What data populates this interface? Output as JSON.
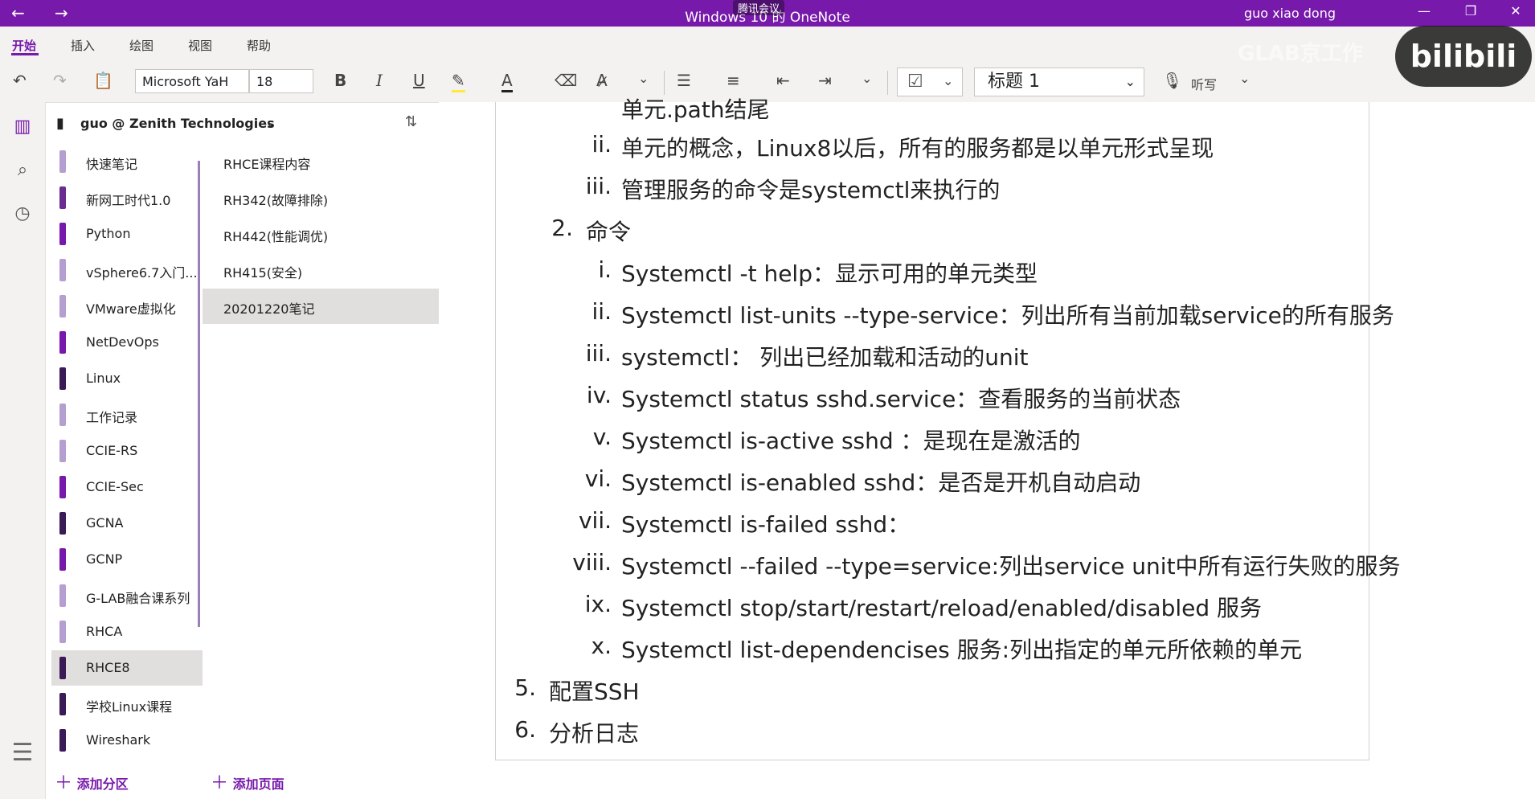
{
  "titlebar": {
    "back": "←",
    "forward": "→",
    "title": "Windows 10 的 OneNote",
    "meeting": "腾讯会议",
    "user": "guo xiao dong",
    "minimize": "—",
    "restore": "❐",
    "close": "✕"
  },
  "menu": [
    "开始",
    "插入",
    "绘图",
    "视图",
    "帮助"
  ],
  "toolbar": {
    "font_name": "Microsoft YaH",
    "font_size": "18",
    "bold": "B",
    "italic": "I",
    "underline": "U",
    "style": "标题 1",
    "dictate": "听写"
  },
  "overlay": {
    "logo": "bilibili",
    "watermark": "GLAB京工作"
  },
  "notebook": {
    "name": "guo @ Zenith Technologies"
  },
  "sections": [
    {
      "label": "快速笔记",
      "color": "#b49fd0"
    },
    {
      "label": "新网工时代1.0",
      "color": "#6a2c91"
    },
    {
      "label": "Python",
      "color": "#7719aa"
    },
    {
      "label": "vSphere6.7入门...",
      "color": "#b49fd0"
    },
    {
      "label": "VMware虚拟化",
      "color": "#b49fd0"
    },
    {
      "label": "NetDevOps",
      "color": "#7719aa"
    },
    {
      "label": "Linux",
      "color": "#3a1b55"
    },
    {
      "label": "工作记录",
      "color": "#b49fd0"
    },
    {
      "label": "CCIE-RS",
      "color": "#b49fd0"
    },
    {
      "label": "CCIE-Sec",
      "color": "#7719aa"
    },
    {
      "label": "GCNA",
      "color": "#3a1b55"
    },
    {
      "label": "GCNP",
      "color": "#7719aa"
    },
    {
      "label": "G-LAB融合课系列",
      "color": "#b49fd0"
    },
    {
      "label": "RHCA",
      "color": "#b49fd0"
    },
    {
      "label": "RHCE8",
      "color": "#3a1b55"
    },
    {
      "label": "学校Linux课程",
      "color": "#3a1b55"
    },
    {
      "label": "Wireshark",
      "color": "#3a1b55"
    }
  ],
  "pages": [
    {
      "label": "RHCE课程内容"
    },
    {
      "label": "RH342(故障排除)"
    },
    {
      "label": "RH442(性能调优)"
    },
    {
      "label": "RH415(安全)"
    },
    {
      "label": "20201220笔记"
    }
  ],
  "footer": {
    "add_section": "添加分区",
    "add_page": "添加页面"
  },
  "note_lines": [
    {
      "num": "",
      "text": "单元.path结尾"
    },
    {
      "num": "ii.",
      "text": "单元的概念，Linux8以后，所有的服务都是以单元形式呈现"
    },
    {
      "num": "iii.",
      "text": "管理服务的命令是systemctl来执行的"
    },
    {
      "num": "2.",
      "text": "命令"
    },
    {
      "num": "i.",
      "text": "Systemctl -t help：显示可用的单元类型"
    },
    {
      "num": "ii.",
      "text": "Systemctl list-units --type-service：列出所有当前加载service的所有服务"
    },
    {
      "num": "iii.",
      "text": "systemctl：  列出已经加载和活动的unit"
    },
    {
      "num": "iv.",
      "text": "Systemctl status sshd.service：查看服务的当前状态"
    },
    {
      "num": "v.",
      "text": "Systemctl is-active sshd  ：是现在是激活的"
    },
    {
      "num": "vi.",
      "text": "Systemctl is-enabled sshd：是否是开机自动启动"
    },
    {
      "num": "vii.",
      "text": "Systemctl is-failed sshd："
    },
    {
      "num": "viii.",
      "text": "Systemctl --failed --type=service:列出service unit中所有运行失败的服务"
    },
    {
      "num": "ix.",
      "text": "Systemctl  stop/start/restart/reload/enabled/disabled 服务"
    },
    {
      "num": "x.",
      "text": "Systemctl list-dependencises 服务:列出指定的单元所依赖的单元"
    },
    {
      "num": "5.",
      "text": "配置SSH"
    },
    {
      "num": "6.",
      "text": "分析日志"
    }
  ]
}
